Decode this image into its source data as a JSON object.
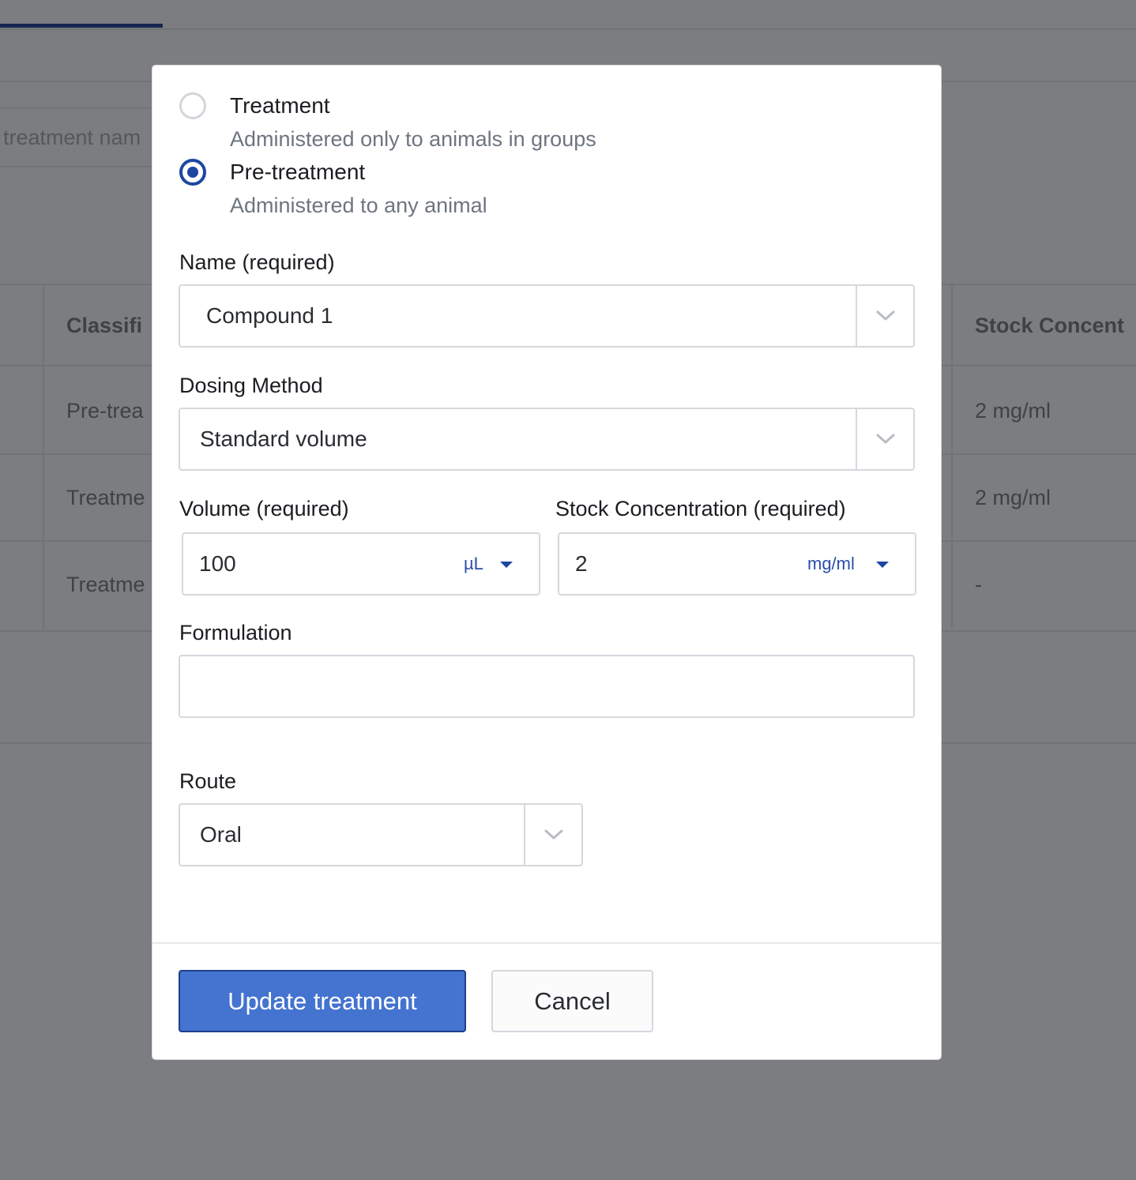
{
  "background": {
    "search_placeholder": "treatment nam",
    "table_headers": [
      "Classifi",
      "Stock Concent"
    ],
    "rows": [
      {
        "classification": "Pre-trea",
        "stock": "2 mg/ml"
      },
      {
        "classification": "Treatme",
        "stock": "2 mg/ml"
      },
      {
        "classification": "Treatme",
        "stock": "-"
      }
    ]
  },
  "modal": {
    "type_options": [
      {
        "title": "Treatment",
        "description": "Administered only to animals in groups",
        "selected": false
      },
      {
        "title": "Pre-treatment",
        "description": "Administered to any animal",
        "selected": true
      }
    ],
    "name": {
      "label": "Name (required)",
      "value": "Compound 1"
    },
    "dosing_method": {
      "label": "Dosing Method",
      "value": "Standard volume"
    },
    "volume": {
      "label": "Volume (required)",
      "value": "100",
      "unit": "µL"
    },
    "stock_concentration": {
      "label": "Stock Concentration (required)",
      "value": "2",
      "unit": "mg/ml"
    },
    "formulation": {
      "label": "Formulation",
      "value": ""
    },
    "route": {
      "label": "Route",
      "value": "Oral"
    },
    "buttons": {
      "primary": "Update treatment",
      "cancel": "Cancel"
    }
  },
  "colors": {
    "primary_button": "#4473d0",
    "radio_selected": "#1e46a0",
    "unit_text": "#2a4ea8",
    "overlay": "#7c7d80"
  },
  "icons": [
    "chevron-down-icon",
    "caret-down-icon"
  ]
}
